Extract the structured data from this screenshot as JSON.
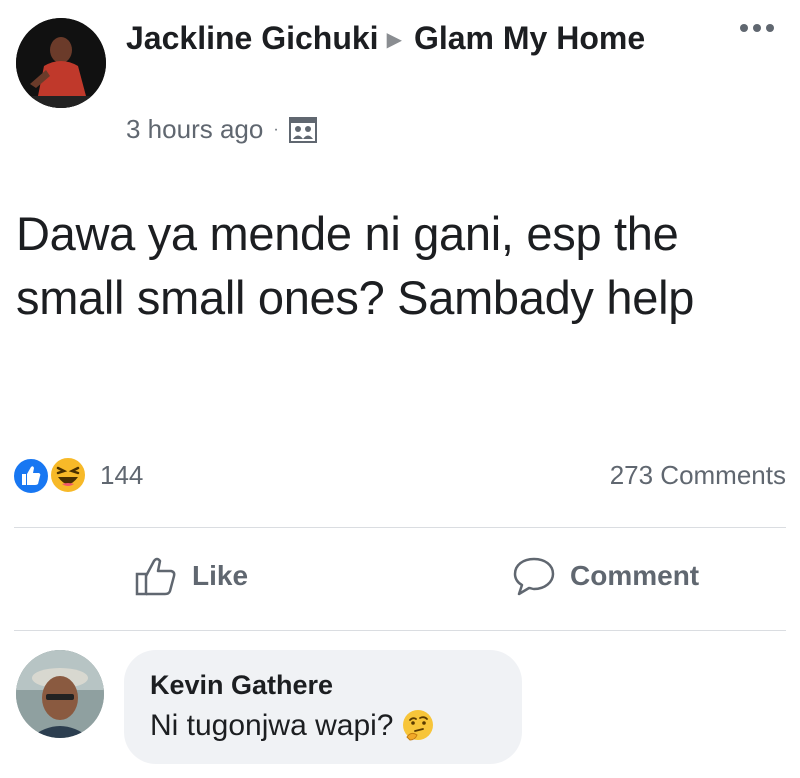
{
  "post": {
    "author": "Jackline Gichuki",
    "group": "Glam My Home",
    "timestamp": "3 hours ago",
    "separator": "·",
    "audience_icon": "group-icon",
    "more_icon": "more-options-icon",
    "text": "Dawa ya mende ni gani, esp the small small ones? Sambady help"
  },
  "reactions": {
    "icons": [
      "like-reaction-icon",
      "haha-reaction-icon"
    ],
    "count": "144",
    "comments_count": "273 Comments"
  },
  "actions": {
    "like_label": "Like",
    "comment_label": "Comment"
  },
  "comment": {
    "author": "Kevin Gathere",
    "text": "Ni tugonjwa wapi?",
    "emoji_icon": "thinking-face-icon"
  },
  "colors": {
    "text_primary": "#1c1e21",
    "text_secondary": "#606770",
    "like_blue": "#1877f2",
    "haha_yellow": "#f7b928",
    "bubble_bg": "#f0f2f5",
    "divider": "#dadde1"
  }
}
